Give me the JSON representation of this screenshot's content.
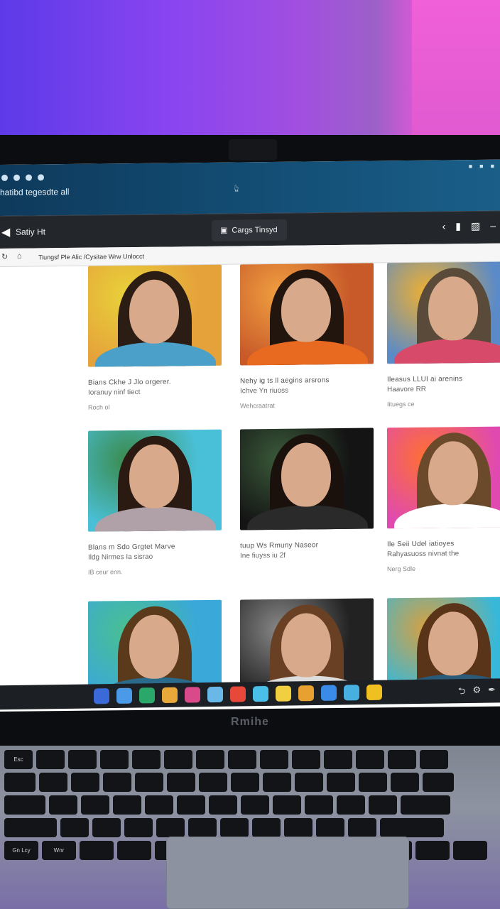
{
  "os": {
    "title": "hatibd tegesdte all"
  },
  "browser": {
    "tab_left": "Satiy Ht",
    "tab_center": "Cargs Tinsyd",
    "address": "Tiungsf Ple Alic /Cysitae Wrw Unlocct"
  },
  "cards": [
    {
      "line1": "Bians Ckhe J Jlo orgerer.",
      "line2": "Ioranuy ninf tiect",
      "meta": "Roch ol",
      "palette": {
        "bg": "#e6a23a",
        "hair": "#2b1c14",
        "shoulder": "#4aa0c8",
        "accent": "#e8d23a"
      }
    },
    {
      "line1": "Nehy ig ts ll aegins arsrons",
      "line2": "Ichve Yn riuoss",
      "meta": "Wehcraatrat",
      "palette": {
        "bg": "#c85a2a",
        "hair": "#22150e",
        "shoulder": "#e86a20",
        "accent": "#f0a040"
      }
    },
    {
      "line1": "Ileasus LLUI ai arenins",
      "line2": "Haavore RR",
      "meta": "Iituegs ce",
      "palette": {
        "bg": "#5a8ac8",
        "hair": "#5a4a3a",
        "shoulder": "#d84a6a",
        "accent": "#f0b030"
      }
    },
    {
      "line1": "Blans m Sdo Grgtet Marve",
      "line2": "Ildg Nirmes Ia sisrao",
      "meta": "IB ceur enn.",
      "palette": {
        "bg": "#4ac0d8",
        "hair": "#2a1a12",
        "shoulder": "#b0a0a8",
        "accent": "#3a8a4a"
      }
    },
    {
      "line1": "tuup Ws Rmuny Naseor",
      "line2": "Ine fiuyss iu 2f",
      "meta": "",
      "palette": {
        "bg": "#141414",
        "hair": "#1a110c",
        "shoulder": "#2a2a2a",
        "accent": "#3a5a3a"
      }
    },
    {
      "line1": "Ile Seii Udel iatioyes",
      "line2": "Rahyasuoss nivnat the",
      "meta": "Nerg Sdle",
      "palette": {
        "bg": "#e04ab0",
        "hair": "#6a4a2a",
        "shoulder": "#ffffff",
        "accent": "#ff7030"
      }
    },
    {
      "line1": "",
      "line2": "",
      "meta": "",
      "palette": {
        "bg": "#3aa8d8",
        "hair": "#5a3a1a",
        "shoulder": "#2a6a8a",
        "accent": "#4ac090"
      }
    },
    {
      "line1": "",
      "line2": "",
      "meta": "",
      "palette": {
        "bg": "#222222",
        "hair": "#6a4024",
        "shoulder": "#dddddd",
        "accent": "#888888"
      }
    },
    {
      "line1": "",
      "line2": "",
      "meta": "",
      "palette": {
        "bg": "#38b8d8",
        "hair": "#5a3418",
        "shoulder": "#2a5a7a",
        "accent": "#d8a040"
      }
    }
  ],
  "dock": {
    "colors": [
      "#3a6ad8",
      "#4a9ae8",
      "#2aa86a",
      "#e8a83a",
      "#d84a8a",
      "#6ab8e8",
      "#e8483a",
      "#4ac0e8",
      "#f0d040",
      "#e8a030",
      "#3a8ae8",
      "#48b0e0",
      "#f0c020"
    ]
  },
  "laptop": {
    "brand": "Rmihe",
    "keys": [
      [
        "Esc",
        "",
        "",
        "",
        "",
        "",
        "",
        "",
        "",
        "",
        "",
        "",
        "",
        ""
      ],
      [
        "",
        "",
        "",
        "",
        "",
        "",
        "",
        "",
        "",
        "",
        "",
        "",
        "",
        ""
      ],
      [
        "",
        "",
        "",
        "",
        "",
        "",
        "",
        "",
        "",
        "",
        "",
        "",
        ""
      ],
      [
        "",
        "",
        "",
        "",
        "",
        "",
        "",
        "",
        "",
        "",
        "",
        ""
      ],
      [
        "Gn Lcy",
        "Wnr",
        "",
        "",
        "",
        "",
        "",
        "",
        "",
        "",
        ""
      ]
    ]
  }
}
